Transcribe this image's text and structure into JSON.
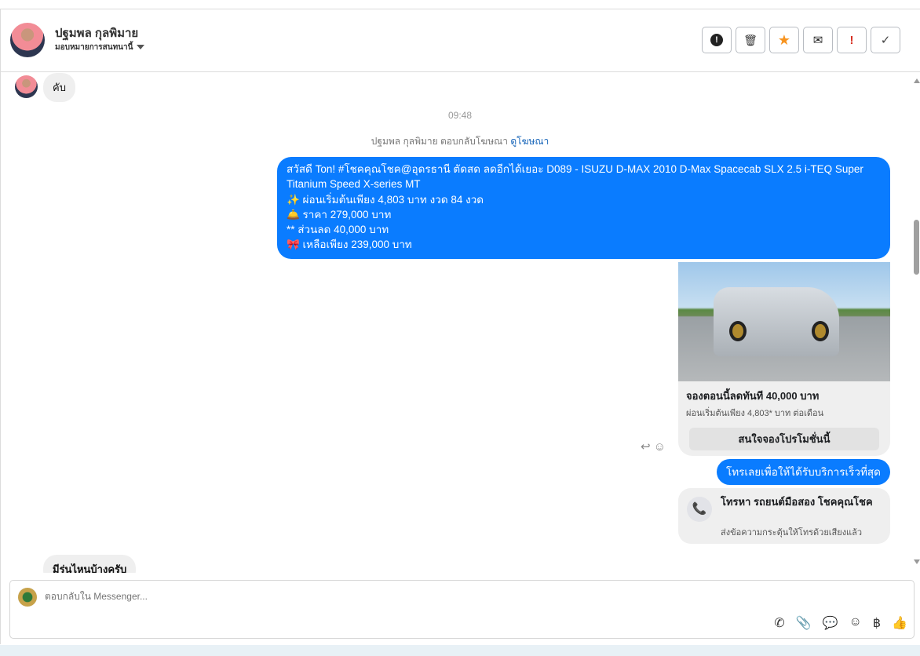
{
  "header": {
    "name": "ปฐมพล กุลพิมาย",
    "assign_label": "มอบหมายการสนทนานี้",
    "actions": [
      {
        "icon": "alert-circle-icon",
        "glyph": "❗"
      },
      {
        "icon": "trash-icon",
        "glyph": "🗑"
      },
      {
        "icon": "star-icon",
        "glyph": "★"
      },
      {
        "icon": "mail-open-icon",
        "glyph": "✉"
      },
      {
        "icon": "exclamation-icon",
        "glyph": "!"
      },
      {
        "icon": "check-icon",
        "glyph": "✓"
      }
    ]
  },
  "messages": {
    "first_in": "คับ",
    "time": "09:48",
    "note_prefix": "ปฐมพล กุลพิมาย ตอบกลับโฆษณา",
    "note_link": "ดูโฆษณา",
    "ad_lines": [
      "สวัสดี Ton! #โชคคุณโชค@อุดรธานี ตัดสด ลดอีกได้เยอะ D089 - ISUZU D-MAX 2010 D-Max Spacecab SLX 2.5 i-TEQ Super Titanium Speed X-series MT",
      "✨ ผ่อนเริ่มต้นเพียง 4,803 บาท งวด 84 งวด",
      "🛎️ ราคา 279,000 บาท",
      "** ส่วนลด 40,000 บาท",
      "🎀 เหลือเพียง 239,000 บาท"
    ],
    "card": {
      "title": "จองตอนนี้ลดทันที 40,000 บาท",
      "subtitle": "ผ่อนเริ่มต้นเพียง 4,803* บาท ต่อเดือน",
      "button": "สนใจจองโปรโมชั่นนี้"
    },
    "call_out": "โทรเลยเพื่อให้ได้รับบริการเร็วที่สุด",
    "call_card": {
      "title": "โทรหา รถยนต์มือสอง โชคคุณโชค",
      "subtitle": "ส่งข้อความกระตุ้นให้โทรด้วยเสียงแล้ว"
    },
    "last_in": "มีรุ่นไหนบ้างครับ"
  },
  "composer": {
    "placeholder": "ตอบกลับใน Messenger..."
  },
  "colors": {
    "accent": "#0a7cff",
    "star": "#f7931e",
    "danger": "#d62d20"
  }
}
